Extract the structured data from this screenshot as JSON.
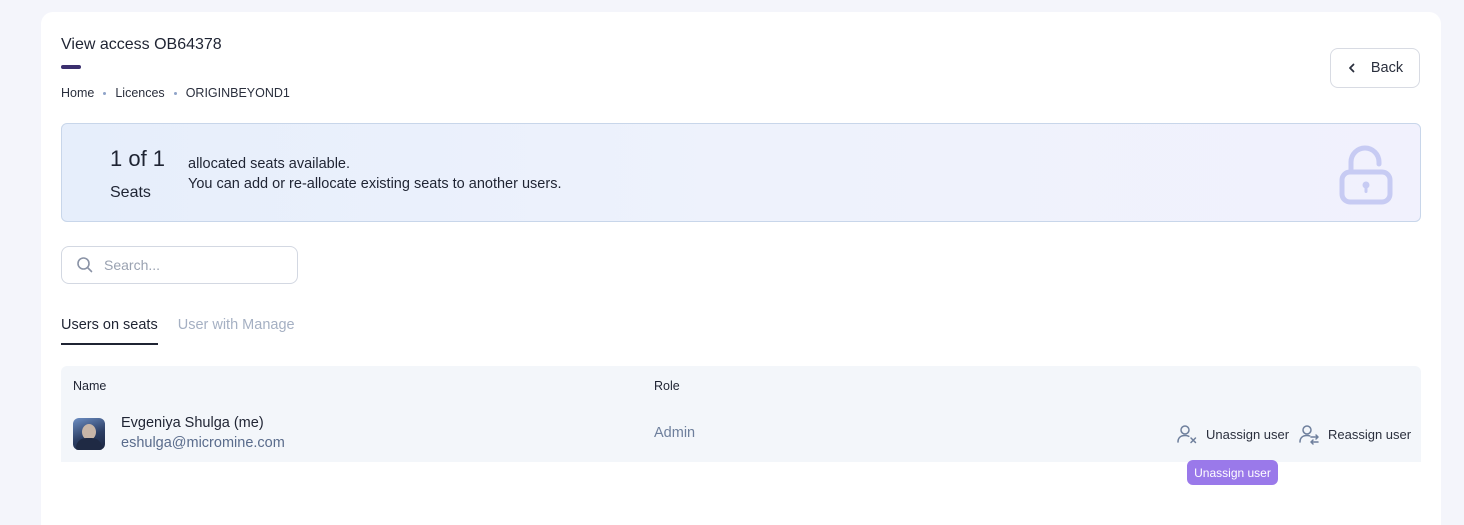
{
  "page": {
    "title": "View access OB64378",
    "back_label": "Back"
  },
  "breadcrumb": [
    "Home",
    "Licences",
    "ORIGINBEYOND1"
  ],
  "banner": {
    "count": "1 of 1",
    "unit": "Seats",
    "line1": "allocated seats available.",
    "line2": "You can add or re-allocate existing seats to another users."
  },
  "search": {
    "placeholder": "Search..."
  },
  "tabs": [
    {
      "label": "Users on seats",
      "active": true
    },
    {
      "label": "User with Manage",
      "active": false
    }
  ],
  "table": {
    "headers": {
      "name": "Name",
      "role": "Role"
    },
    "rows": [
      {
        "name": "Evgeniya Shulga (me)",
        "email": "eshulga@micromine.com",
        "role": "Admin",
        "unassign_label": "Unassign user",
        "reassign_label": "Reassign user"
      }
    ]
  },
  "tooltip": "Unassign user",
  "icons": {
    "back": "chevron-left-icon",
    "lock": "unlocked-padlock-icon",
    "search": "search-icon",
    "unassign": "user-remove-icon",
    "reassign": "user-swap-icon"
  },
  "colors": {
    "accent": "#3b2f6e",
    "tooltip_bg": "#9a79ea",
    "banner_border": "#c8d6ea",
    "lock": "#c7cbf3"
  }
}
